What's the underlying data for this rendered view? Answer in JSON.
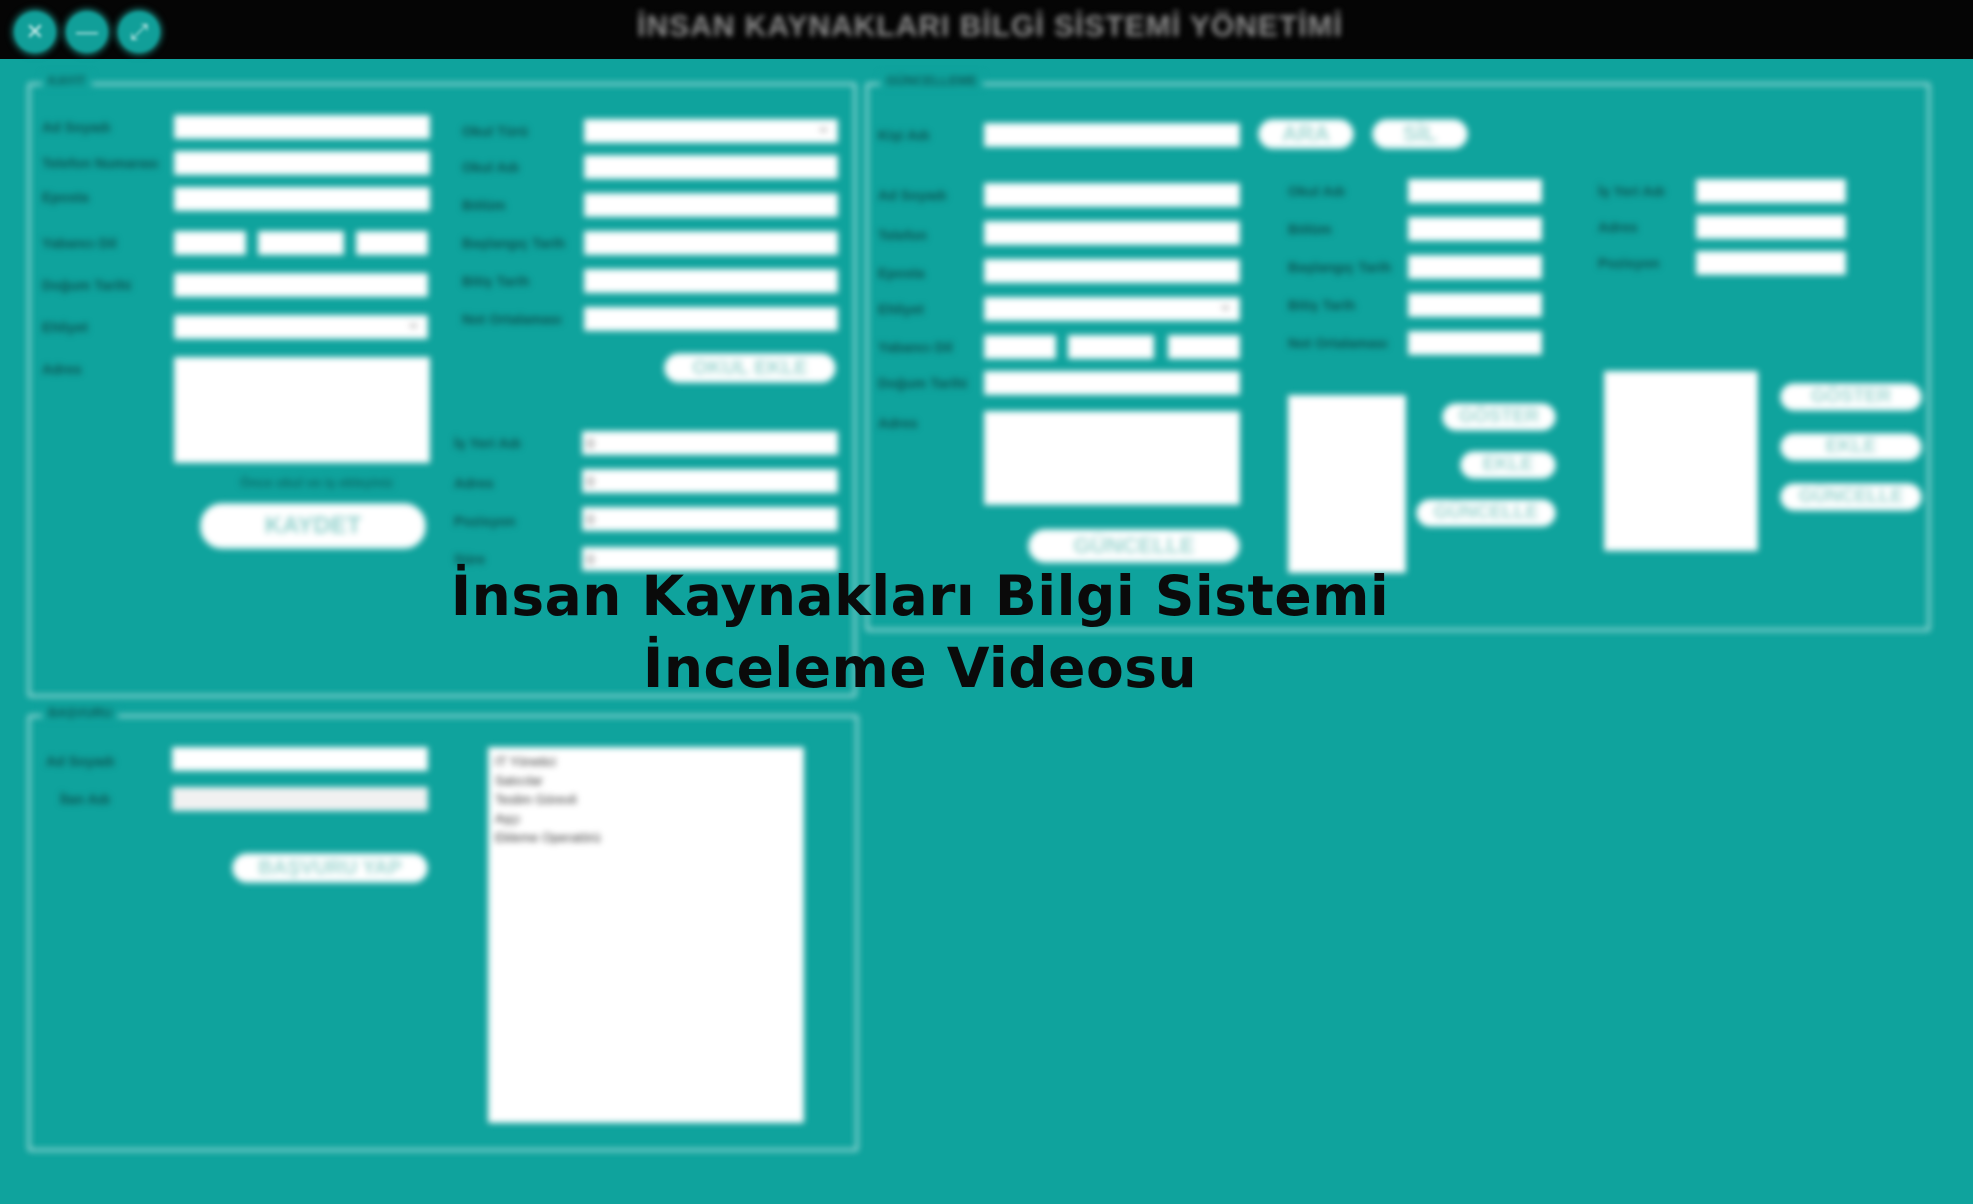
{
  "window": {
    "title": "İNSAN KAYNAKLARI BİLGİ SİSTEMİ YÖNETİMİ",
    "controls": {
      "close": "✕",
      "minimize": "—",
      "maximize": "⤢"
    }
  },
  "kayit": {
    "legend": "KAYIT",
    "labels": {
      "ad_soyad": "Ad Soyadı",
      "telefon": "Telefon Numarası",
      "eposta": "Eposta",
      "yabanci_dil": "Yabancı Dil",
      "dogum_tarihi": "Doğum Tarihi",
      "ehliyet": "Ehliyet",
      "adres": "Adres"
    },
    "okul": {
      "labels": {
        "okul_turu": "Okul Türü",
        "okul_adi": "Okul Adı",
        "bolum": "Bölüm",
        "baslangic": "Başlangıç Tarih",
        "bitis": "Bitiş Tarih",
        "not_ortalamasi": "Not Ortalaması"
      },
      "add_button": "OKUL EKLE"
    },
    "is": {
      "labels": {
        "is_yeri_adi": "İş Yeri Adı",
        "adres": "Adres",
        "pozisyon": "Pozisyon",
        "sure": "Süre"
      },
      "values": [
        "0",
        "0",
        "0",
        "0"
      ]
    },
    "hint": "Önce okul ve iş ekleyiniz",
    "save_button": "KAYDET"
  },
  "guncelleme": {
    "legend": "GÜNCELLEME",
    "search_label": "Kişi Adı",
    "search_button": "ARA",
    "delete_button": "SİL",
    "labels": {
      "ad_soyad": "Ad Soyadı",
      "telefon": "Telefon",
      "eposta": "Eposta",
      "ehliyet": "Ehliyet",
      "yabanci_dil": "Yabancı Dil",
      "dogum_tarihi": "Doğum Tarihi",
      "adres": "Adres"
    },
    "update_button": "GÜNCELLE",
    "okul": {
      "labels": {
        "okul_adi": "Okul Adı",
        "bolum": "Bölüm",
        "baslangic": "Başlangıç Tarih",
        "bitis": "Bitiş Tarih",
        "not_ortalamasi": "Not Ortalaması"
      },
      "show_button": "GÖSTER",
      "add_button": "EKLE",
      "update_button": "GÜNCELLE"
    },
    "is": {
      "labels": {
        "is_yeri_adi": "İş Yeri Adı",
        "adres": "Adres",
        "pozisyon": "Pozisyon"
      },
      "show_button": "GÖSTER",
      "add_button": "EKLE",
      "update_button": "GÜNCELLE"
    }
  },
  "basvuru": {
    "legend": "BAŞVURU",
    "labels": {
      "ad_soyad": "Ad Soyadı",
      "ilan_adi": "İlan Adı"
    },
    "apply_button": "BAŞVURU YAP",
    "ilanlar": [
      "IT Yönetici",
      "Satıcılar",
      "Teslim Görevli",
      "Aşçı",
      "Ekleme Operatörü"
    ]
  },
  "overlay": {
    "line1": "İnsan Kaynakları Bilgi Sistemi",
    "line2": "İnceleme Videosu"
  }
}
